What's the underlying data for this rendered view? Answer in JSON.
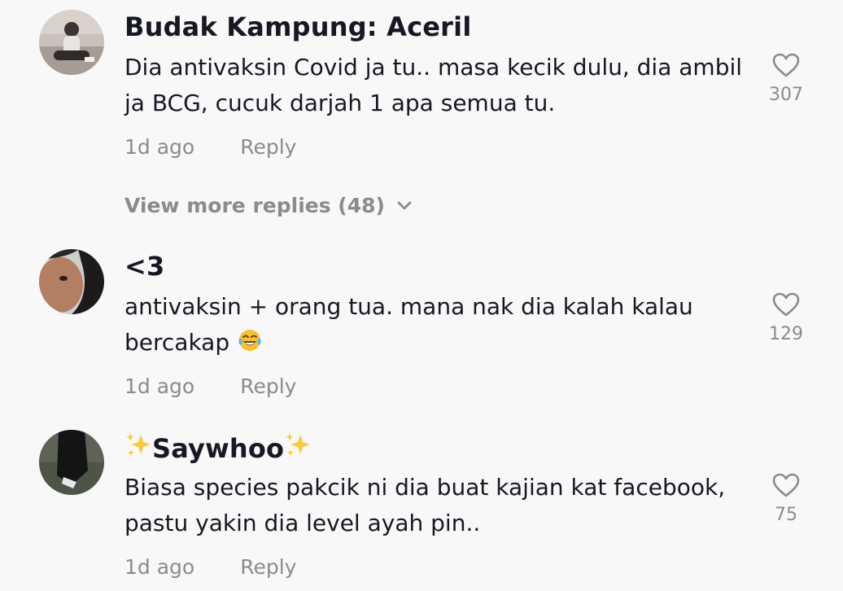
{
  "comments": [
    {
      "username": "Budak Kampung: Aceril",
      "text": "Dia antivaksin Covid ja tu.. masa kecik dulu, dia ambil ja BCG, cucuk darjah 1 apa semua tu.",
      "time": "1d ago",
      "reply_label": "Reply",
      "likes": "307"
    },
    {
      "username": "<3",
      "text": "antivaksin + orang tua. mana nak dia kalah kalau bercakap",
      "emoji": "face-with-tears-of-joy",
      "time": "1d ago",
      "reply_label": "Reply",
      "likes": "129"
    },
    {
      "username": "Saywhoo",
      "username_decoration": "sparkles",
      "text": "Biasa species pakcik ni dia buat kajian kat facebook, pastu yakin dia level ayah pin..",
      "time": "1d ago",
      "reply_label": "Reply",
      "likes": "75"
    }
  ],
  "view_more_replies": "View more replies (48)",
  "colors": {
    "background": "#f8f8f8",
    "text": "#161823",
    "muted": "#8a8b91"
  }
}
